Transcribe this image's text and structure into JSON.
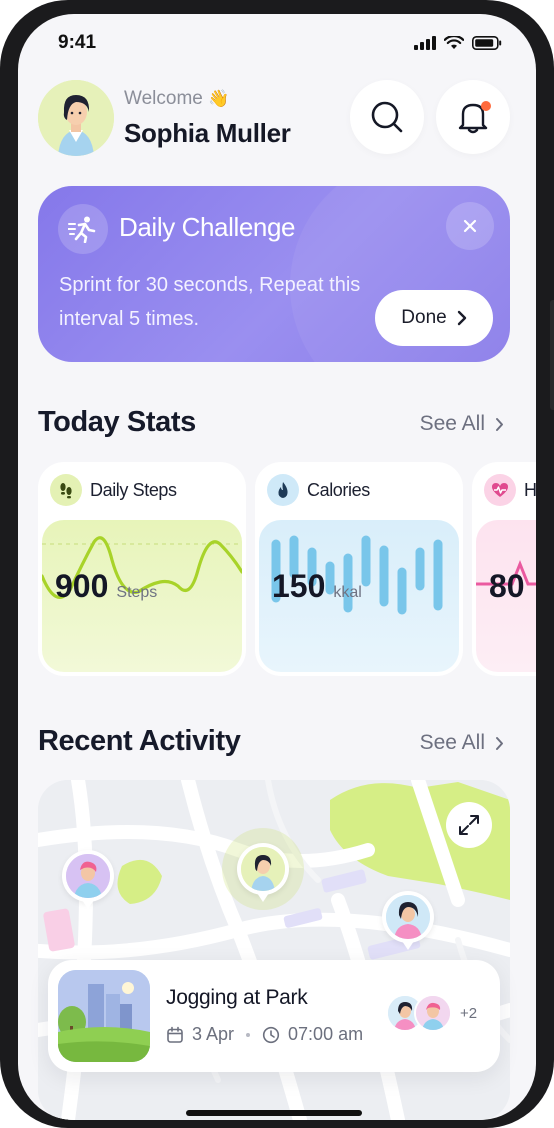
{
  "status_bar": {
    "time": "9:41",
    "icons": [
      "signal-icon",
      "wifi-icon",
      "battery-icon"
    ]
  },
  "header": {
    "welcome": "Welcome",
    "welcome_emoji": "👋",
    "user_name": "Sophia Muller",
    "search_icon": "search-icon",
    "notification_icon": "bell-icon",
    "has_unread": true
  },
  "challenge": {
    "title": "Daily Challenge",
    "description": "Sprint for 30 seconds, Repeat this interval 5 times.",
    "done_label": "Done",
    "icon": "running-icon",
    "close_icon": "close-icon"
  },
  "today_stats": {
    "title": "Today Stats",
    "see_all": "See All",
    "cards": [
      {
        "label": "Daily Steps",
        "value": "900",
        "unit": "Steps",
        "icon": "footprints-icon",
        "color": "#cde77a"
      },
      {
        "label": "Calories",
        "value": "150",
        "unit": "kkal",
        "icon": "flame-icon",
        "color": "#7cc3e8"
      },
      {
        "label": "H",
        "value": "80",
        "unit": "",
        "icon": "heart-rate-icon",
        "color": "#f07ab4"
      }
    ]
  },
  "recent_activity": {
    "title": "Recent Activity",
    "see_all": "See All",
    "expand_icon": "expand-icon",
    "item": {
      "title": "Jogging at Park",
      "date": "3 Apr",
      "time": "07:00 am",
      "extra_participants": "+2"
    }
  },
  "colors": {
    "accent_purple": "#8a7ce9",
    "lime": "#cde77a",
    "blue": "#7cc3e8",
    "pink": "#f07ab4",
    "notification_dot": "#ff6a3d"
  }
}
